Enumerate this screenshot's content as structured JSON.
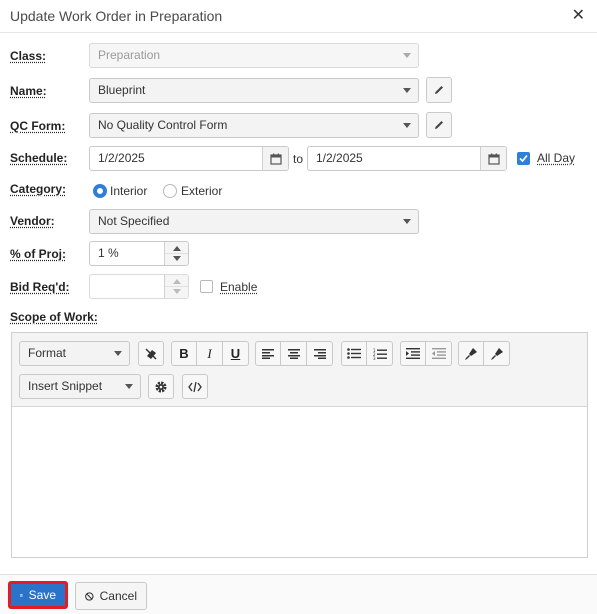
{
  "dialog": {
    "title": "Update Work Order in Preparation",
    "close_symbol": "✕"
  },
  "fields": {
    "class": {
      "label": "Class:",
      "value": "Preparation"
    },
    "name": {
      "label": "Name:",
      "value": "Blueprint"
    },
    "qc_form": {
      "label": "QC Form:",
      "value": "No Quality Control Form"
    },
    "schedule": {
      "label": "Schedule:",
      "start": "1/2/2025",
      "to": "to",
      "end": "1/2/2025",
      "all_day_label": "All Day",
      "all_day_checked": true
    },
    "category": {
      "label": "Category:",
      "options": [
        "Interior",
        "Exterior"
      ],
      "selected": "Interior"
    },
    "vendor": {
      "label": "Vendor:",
      "value": "Not Specified"
    },
    "percent": {
      "label": "% of Proj:",
      "value": "1 %"
    },
    "bid": {
      "label": "Bid Req'd:",
      "value": "",
      "enable_label": "Enable",
      "enable_checked": false
    },
    "scope": {
      "label": "Scope of Work:"
    }
  },
  "editor": {
    "format_label": "Format",
    "snippet_label": "Insert Snippet",
    "bold": "B",
    "italic": "I",
    "underline": "U"
  },
  "footer": {
    "save_label": "Save",
    "cancel_label": "Cancel"
  },
  "colors": {
    "accent": "#2f7fd8",
    "save_bg": "#2b73c9",
    "highlight": "#e31b23"
  }
}
